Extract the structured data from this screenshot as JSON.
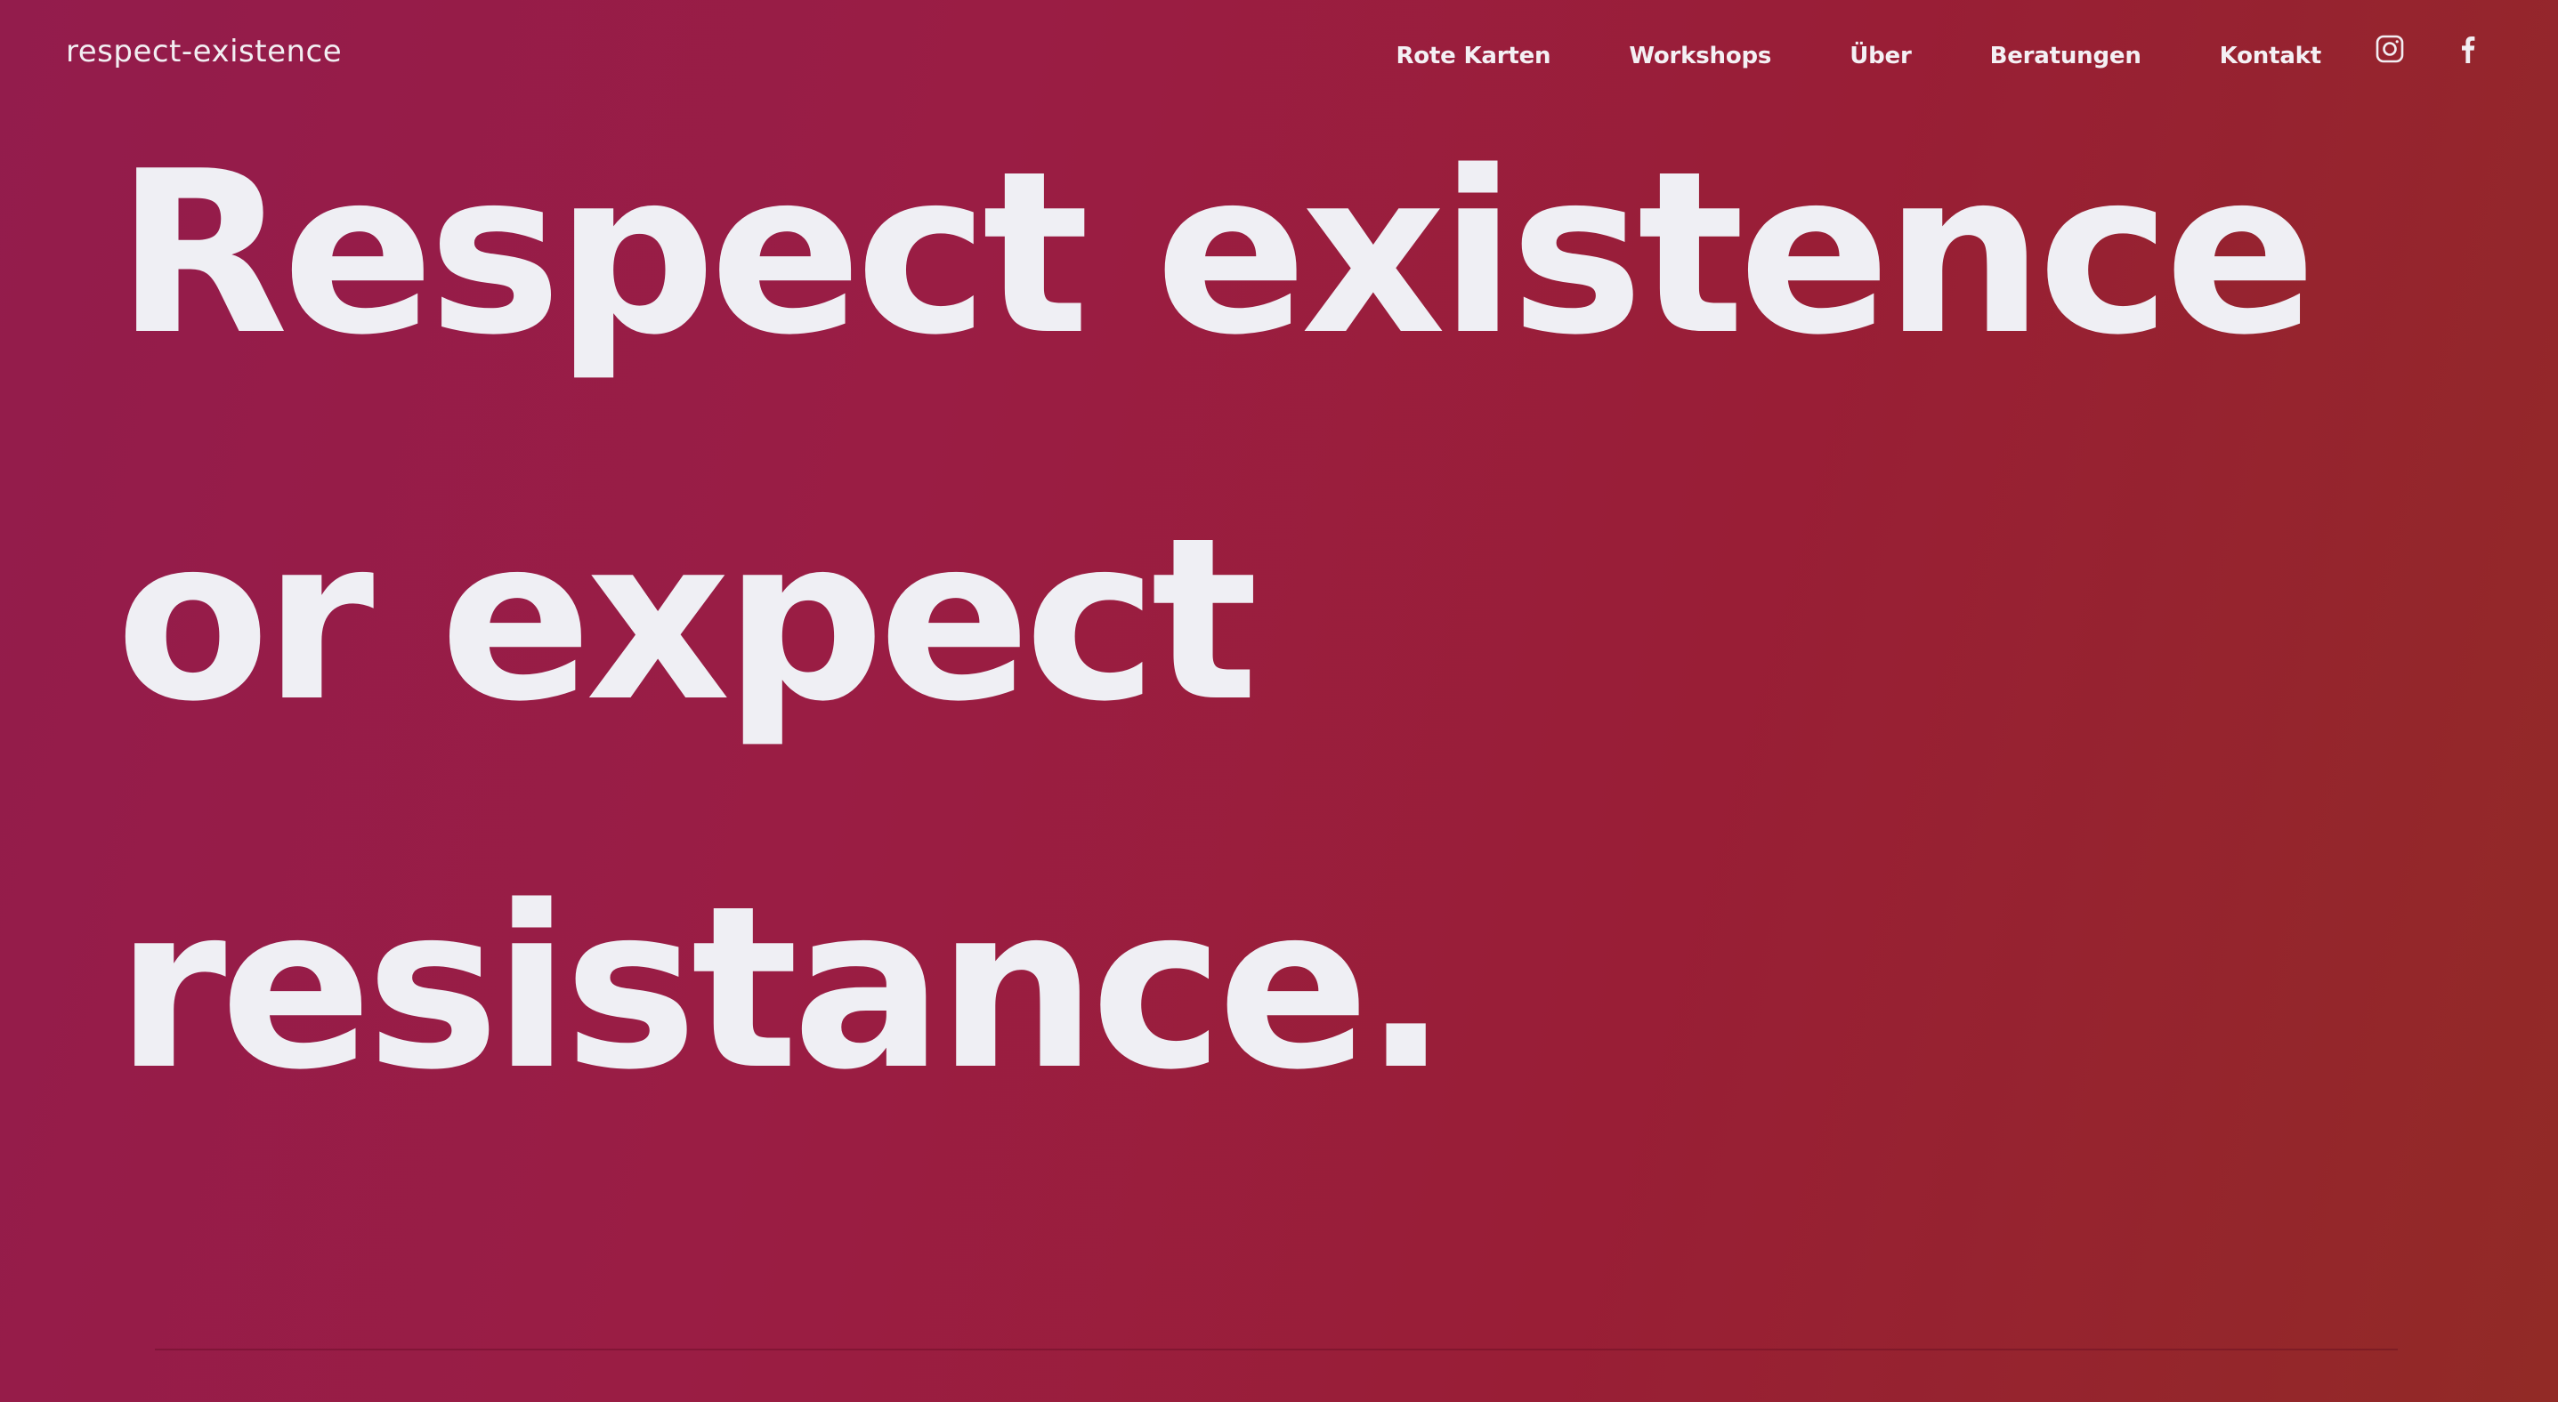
{
  "header": {
    "logo_text": "respect-existence"
  },
  "nav": {
    "items": [
      {
        "label": "Rote Karten"
      },
      {
        "label": "Workshops"
      },
      {
        "label": "Über"
      },
      {
        "label": "Beratungen"
      },
      {
        "label": "Kontakt"
      }
    ]
  },
  "social": {
    "icons": [
      "instagram-icon",
      "facebook-icon"
    ]
  },
  "hero": {
    "lines": [
      "Respect existence",
      "or expect",
      "resistance."
    ]
  },
  "colors": {
    "background_start": "#931c4c",
    "background_end": "#922a26",
    "text": "#efeff4"
  }
}
